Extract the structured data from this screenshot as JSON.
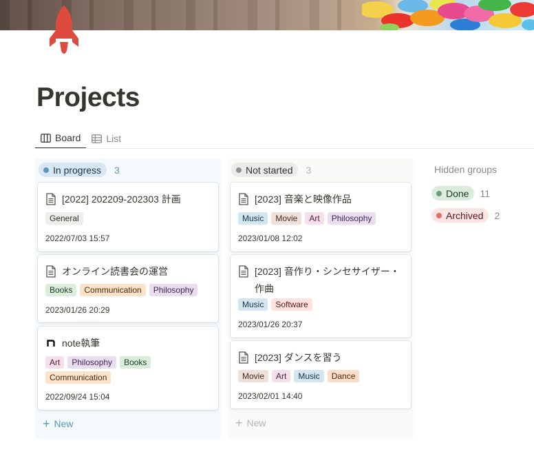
{
  "page": {
    "title": "Projects"
  },
  "views": {
    "tabs": [
      {
        "label": "Board",
        "icon": "board-icon",
        "active": true
      },
      {
        "label": "List",
        "icon": "table-icon",
        "active": false
      }
    ]
  },
  "board": {
    "columns": [
      {
        "label": "In progress",
        "count": "3",
        "color": "#5b97bd",
        "new_label": "New",
        "cards": [
          {
            "icon": "page-icon",
            "title": "[2022] 202209-202303 計画",
            "tags": [
              {
                "label": "General",
                "color": "#eeeeed"
              }
            ],
            "date": "2022/07/03 15:57"
          },
          {
            "icon": "page-icon",
            "title": "オンライン読書会の運営",
            "tags": [
              {
                "label": "Books",
                "color": "#dbeddb"
              },
              {
                "label": "Communication",
                "color": "#fae3c8"
              },
              {
                "label": "Philosophy",
                "color": "#e8deee"
              }
            ],
            "date": "2023/01/26 20:29"
          },
          {
            "icon": "note-logo-icon",
            "title": "note執筆",
            "tags": [
              {
                "label": "Art",
                "color": "#f5e0e9"
              },
              {
                "label": "Philosophy",
                "color": "#e8deee"
              },
              {
                "label": "Books",
                "color": "#dbeddb"
              },
              {
                "label": "Communication",
                "color": "#fae3c8"
              }
            ],
            "date": "2022/09/24 15:04"
          }
        ]
      },
      {
        "label": "Not started",
        "count": "3",
        "color": "#91918e",
        "new_label": "New",
        "cards": [
          {
            "icon": "page-icon",
            "title": "[2023] 音楽と映像作品",
            "tags": [
              {
                "label": "Music",
                "color": "#d3e5ef"
              },
              {
                "label": "Movie",
                "color": "#eee0da"
              },
              {
                "label": "Art",
                "color": "#f5e0e9"
              },
              {
                "label": "Philosophy",
                "color": "#e8deee"
              }
            ],
            "date": "2023/01/08 12:02"
          },
          {
            "icon": "page-icon",
            "title": "[2023] 音作り・シンセサイザー・作曲",
            "tags": [
              {
                "label": "Music",
                "color": "#d3e5ef"
              },
              {
                "label": "Software",
                "color": "#ffe2dd"
              }
            ],
            "date": "2023/01/26 20:37"
          },
          {
            "icon": "page-icon",
            "title": "[2023] ダンスを習う",
            "tags": [
              {
                "label": "Movie",
                "color": "#eee0da"
              },
              {
                "label": "Art",
                "color": "#f5e0e9"
              },
              {
                "label": "Music",
                "color": "#d3e5ef"
              },
              {
                "label": "Dance",
                "color": "#fadec9"
              }
            ],
            "date": "2023/02/01 14:40"
          }
        ]
      }
    ],
    "hidden_groups": {
      "label": "Hidden groups",
      "groups": [
        {
          "label": "Done",
          "count": "11",
          "color": "#6c9b7d"
        },
        {
          "label": "Archived",
          "count": "2",
          "color": "#e16f64"
        }
      ]
    }
  }
}
